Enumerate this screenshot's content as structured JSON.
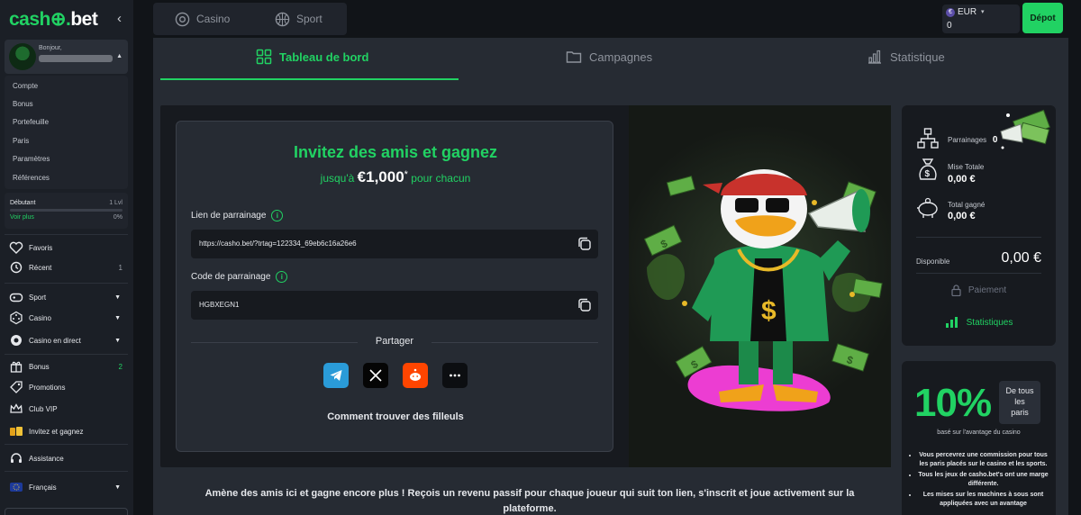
{
  "brand": {
    "logo_part1": "cash",
    "logo_part2": "bet",
    "accent": "#21d263"
  },
  "sidebar": {
    "greeting": "Bonjour,",
    "account_items": [
      "Compte",
      "Bonus",
      "Portefeuille",
      "Paris",
      "Paramètres",
      "Références"
    ],
    "level": {
      "name": "Débutant",
      "value": "1 Lvl",
      "more": "Voir plus",
      "progress": "0%"
    },
    "nav": {
      "favoris": "Favoris",
      "recent": "Récent",
      "recent_count": "1",
      "sport": "Sport",
      "casino": "Casino",
      "casino_live": "Casino en direct",
      "bonus": "Bonus",
      "bonus_count": "2",
      "promotions": "Promotions",
      "club_vip": "Club VIP",
      "invite": "Invitez et gagnez",
      "assistance": "Assistance",
      "language": "Français"
    }
  },
  "topbar": {
    "tabs": [
      "Casino",
      "Sport"
    ],
    "wallet": {
      "currency_symbol": "€",
      "currency": "EUR",
      "balance": "0"
    },
    "deposit": "Dépot"
  },
  "subtabs": [
    "Tableau de bord",
    "Campagnes",
    "Statistique"
  ],
  "invite": {
    "title": "Invitez des amis et gagnez",
    "sub_pre": "jusqu'à",
    "amount": "€1,000",
    "star": "*",
    "sub_post": "pour chacun",
    "link_label": "Lien de parrainage",
    "link_value": "https://casho.bet/?trtag=122334_69eb6c16a26e6",
    "code_label": "Code de parrainage",
    "code_value": "HGBXEGN1",
    "share_label": "Partager",
    "find_link": "Comment trouver des filleuls"
  },
  "description": "Amène des amis ici et gagne encore plus ! Reçois un revenu passif pour chaque joueur qui suit ton lien, s'inscrit et joue activement sur la plateforme.",
  "stats": {
    "parrainages_label": "Parrainages",
    "parrainages_value": "0",
    "mise_label": "Mise Totale",
    "mise_value": "0,00 €",
    "gain_label": "Total gagné",
    "gain_value": "0,00 €",
    "dispo_label": "Disponible",
    "dispo_value": "0,00 €",
    "payment": "Paiement",
    "statistics": "Statistiques"
  },
  "promo": {
    "percent": "10%",
    "box_lines": [
      "De tous",
      "les",
      "paris"
    ],
    "note": "basé sur l'avantage du casino",
    "bullets": [
      "Vous percevrez une commission pour tous les paris placés sur le casino et les sports.",
      "Tous les jeux de casho.bet's ont une marge différente.",
      "Les mises sur les machines à sous sont appliquées avec un avantage"
    ]
  }
}
